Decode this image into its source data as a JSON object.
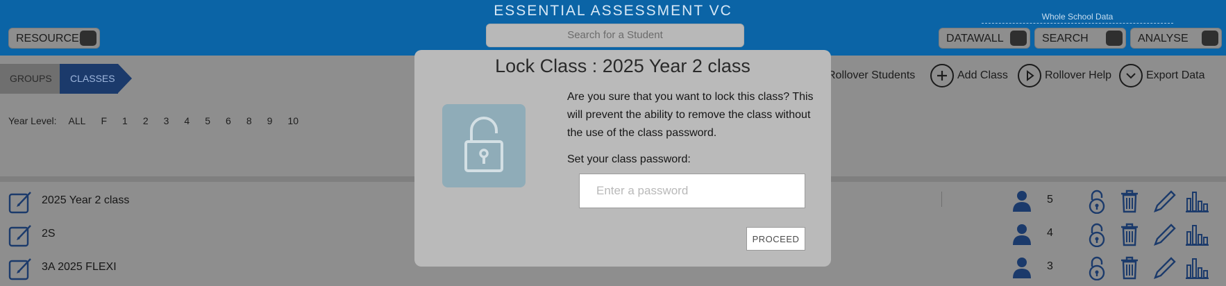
{
  "header": {
    "title": "ESSENTIAL ASSESSMENT VC",
    "search_placeholder": "Search for a Student",
    "resources_label": "RESOURCES",
    "whole_school_label": "Whole School Data",
    "datawall_label": "DATAWALL",
    "search_label": "SEARCH",
    "analyse_label": "ANALYSE"
  },
  "breadcrumb": {
    "groups": "GROUPS",
    "classes": "CLASSES"
  },
  "year_level": {
    "label": "Year Level:",
    "options": [
      "ALL",
      "F",
      "1",
      "2",
      "3",
      "4",
      "5",
      "6",
      "8",
      "9",
      "10"
    ]
  },
  "actions": {
    "rollover_students": "Rollover Students",
    "add_class": "Add Class",
    "rollover_help": "Rollover Help",
    "export_data": "Export Data"
  },
  "classes": [
    {
      "name": "2025 Year 2 class",
      "students": "5"
    },
    {
      "name": "2S",
      "students": "4"
    },
    {
      "name": "3A 2025 FLEXI",
      "students": "3"
    }
  ],
  "modal": {
    "title": "Lock Class : 2025 Year 2 class",
    "message": "Are you sure that you want to lock this class? This will prevent the ability to remove the class without the use of the class password.",
    "password_label": "Set your class password:",
    "password_placeholder": "Enter a password",
    "proceed_label": "PROCEED"
  },
  "colors": {
    "header_blue": "#0b64a6",
    "overlay_gray": "#8e8e8e",
    "modal_gray": "#bababa",
    "icon_navy": "#1b3a6b",
    "lock_tile": "#8facb8"
  }
}
